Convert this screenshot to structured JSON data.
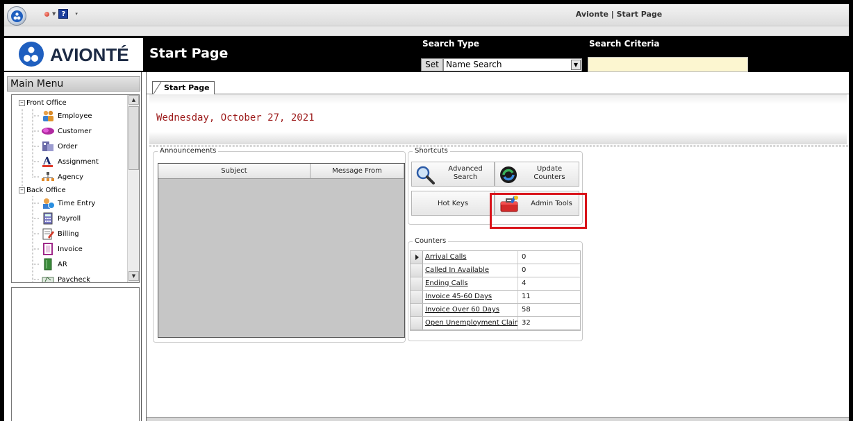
{
  "window": {
    "title": "Avionte | Start Page"
  },
  "header": {
    "logo_text": "AVIONTÉ",
    "page_title": "Start Page",
    "search_type_label": "Search Type",
    "search_criteria_label": "Search Criteria",
    "set_button": "Set",
    "search_type_value": "Name Search",
    "search_criteria_value": ""
  },
  "sidebar": {
    "title": "Main Menu",
    "groups": [
      {
        "label": "Front Office",
        "items": [
          {
            "label": "Employee",
            "icon": "employee-icon"
          },
          {
            "label": "Customer",
            "icon": "customer-icon"
          },
          {
            "label": "Order",
            "icon": "order-icon"
          },
          {
            "label": "Assignment",
            "icon": "assignment-icon"
          },
          {
            "label": "Agency",
            "icon": "agency-icon"
          }
        ]
      },
      {
        "label": "Back Office",
        "items": [
          {
            "label": "Time Entry",
            "icon": "time-entry-icon"
          },
          {
            "label": "Payroll",
            "icon": "payroll-icon"
          },
          {
            "label": "Billing",
            "icon": "billing-icon"
          },
          {
            "label": "Invoice",
            "icon": "invoice-icon"
          },
          {
            "label": "AR",
            "icon": "ar-icon"
          },
          {
            "label": "Paycheck",
            "icon": "paycheck-icon"
          }
        ]
      }
    ]
  },
  "tabs": [
    {
      "label": "Start Page"
    }
  ],
  "main": {
    "date": "Wednesday, October 27, 2021",
    "announcements": {
      "title": "Announcements",
      "columns": [
        "Subject",
        "Message From"
      ]
    },
    "shortcuts": {
      "title": "Shortcuts",
      "buttons": [
        {
          "label_line1": "Advanced",
          "label_line2": "Search",
          "icon": "magnifier-icon"
        },
        {
          "label_line1": "Update",
          "label_line2": "Counters",
          "icon": "refresh-icon"
        },
        {
          "label": "Hot Keys"
        },
        {
          "label": "Admin Tools",
          "icon": "toolbox-icon"
        }
      ]
    },
    "counters": {
      "title": "Counters",
      "rows": [
        {
          "name": "Arrival Calls",
          "value": "0"
        },
        {
          "name": "Called In Available",
          "value": "0"
        },
        {
          "name": "Ending Calls",
          "value": "4"
        },
        {
          "name": "Invoice 45-60 Days",
          "value": "11"
        },
        {
          "name": "Invoice Over 60 Days",
          "value": "58"
        },
        {
          "name": "Open Unemployment Claim",
          "value": "32"
        }
      ]
    }
  },
  "colors": {
    "date_text": "#9c1a1a",
    "highlight": "#d9141b",
    "brand_blue": "#1f5fbf",
    "search_criteria_bg": "#fcf6d0"
  }
}
